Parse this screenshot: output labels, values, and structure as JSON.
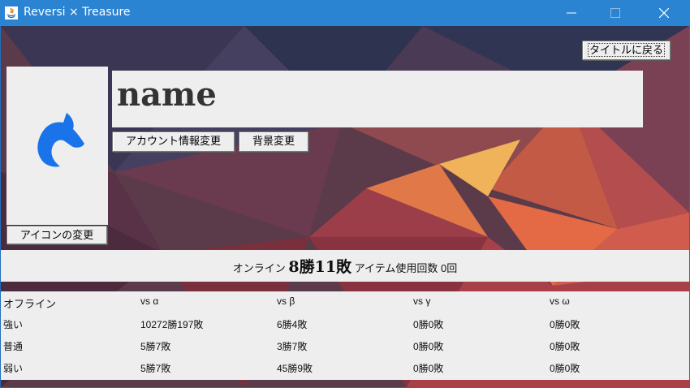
{
  "window": {
    "title": "Reversi × Treasure"
  },
  "header": {
    "back_label": "タイトルに戻る"
  },
  "profile": {
    "name": "name",
    "account_button": "アカウント情報変更",
    "background_button": "背景変更",
    "icon_button": "アイコンの変更",
    "avatar_icon": "horse-knight-icon"
  },
  "online": {
    "label": "オンライン",
    "record": "8勝11敗",
    "items_label": "アイテム使用回数 0回"
  },
  "stats": {
    "headers": [
      "オフライン",
      "vs α",
      "vs β",
      "vs γ",
      "vs ω"
    ],
    "rows": [
      [
        "強い",
        "10272勝197敗",
        "6勝4敗",
        "0勝0敗",
        "0勝0敗"
      ],
      [
        "普通",
        "5勝7敗",
        "3勝7敗",
        "0勝0敗",
        "0勝0敗"
      ],
      [
        "弱い",
        "5勝7敗",
        "45勝9敗",
        "0勝0敗",
        "0勝0敗"
      ]
    ]
  },
  "colors": {
    "titlebar": "#2b84d2",
    "panel": "#eeeeee",
    "avatar": "#1a73e8"
  }
}
